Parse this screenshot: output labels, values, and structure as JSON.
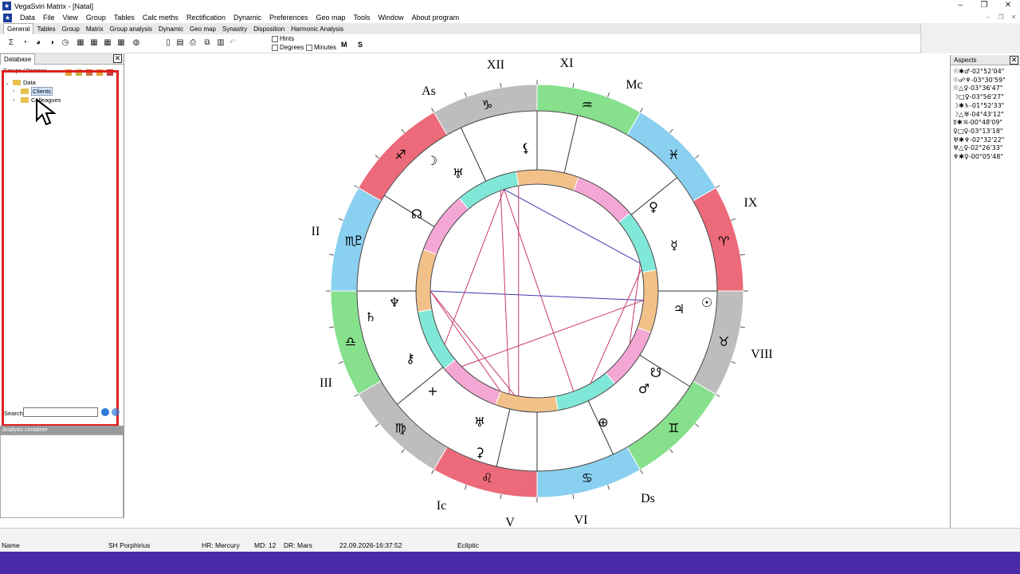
{
  "window": {
    "title": "VegaSviri Matrix - [Natal]",
    "icon": "app-logo-icon"
  },
  "menu": [
    "Data",
    "File",
    "View",
    "Group",
    "Tables",
    "Calc meths",
    "Rectification",
    "Dynamic",
    "Preferences",
    "Geo map",
    "Tools",
    "Window",
    "About program"
  ],
  "tabs": [
    "General",
    "Tables",
    "Group",
    "Matrix",
    "Group analysis",
    "Dynamic",
    "Geo map",
    "Synastry",
    "Disposition",
    "Harmonic Analysis"
  ],
  "toolbar": {
    "hints_label": "Hints",
    "degrees_label": "Degrees",
    "minutes_label": "Minutes",
    "m_label": "M",
    "s_label": "S"
  },
  "database": {
    "title": "Database",
    "groups_header": "Groups / Persons",
    "tree": {
      "root": "Data",
      "children": [
        "Clients",
        "Colleagues"
      ]
    },
    "search_label": "Search",
    "search_value": ""
  },
  "analysis": {
    "title": "Analysis container"
  },
  "aspects": {
    "title": "Aspects",
    "rows": [
      "☉✱♂-02°52'04\"",
      "☉☍♆-03°30'59\"",
      "☉△♀-03°36'47\"",
      "☽□♀-03°56'27\"",
      "☽✱♄-01°52'33\"",
      "☽△♅-04°43'12\"",
      "☿✱♃-00°48'09\"",
      "♀□♀-03°13'18\"",
      "♅✱♆-02°32'22\"",
      "♅△♀-02°26'33\"",
      "♆✱♀-00°05'48\""
    ]
  },
  "chart": {
    "house_numerals": [
      "XII",
      "XI",
      "IX",
      "VIII",
      "VI",
      "V",
      "III",
      "II"
    ],
    "angles": [
      "As",
      "Mc",
      "Ds",
      "Ic"
    ],
    "zodiac_glyphs": [
      "♑",
      "♐",
      "♏",
      "♎",
      "♍",
      "♌",
      "♋",
      "♊",
      "♉",
      "♈",
      "♓",
      "♒"
    ],
    "zodiac_colors": {
      "fire": "#ec6a7a",
      "earth": "#bdbdbd",
      "air": "#86e08c",
      "water": "#8ad0f0"
    },
    "planets": [
      "⚸",
      "♅",
      "♀",
      "☿",
      "☽",
      "♇",
      "☊",
      "♆",
      "♄",
      "⚷",
      "☉",
      "♃",
      "☋",
      "♂",
      "⊕",
      "+",
      "♅",
      "⚳"
    ]
  },
  "status": {
    "name": "Name",
    "house_system": "SH Porphirius",
    "hr": "HR: Mercury",
    "md": "MD: 12",
    "dr": "DR: Mars",
    "datetime": "22.09.2026-16:37:52",
    "coords": "Ecliptic"
  }
}
